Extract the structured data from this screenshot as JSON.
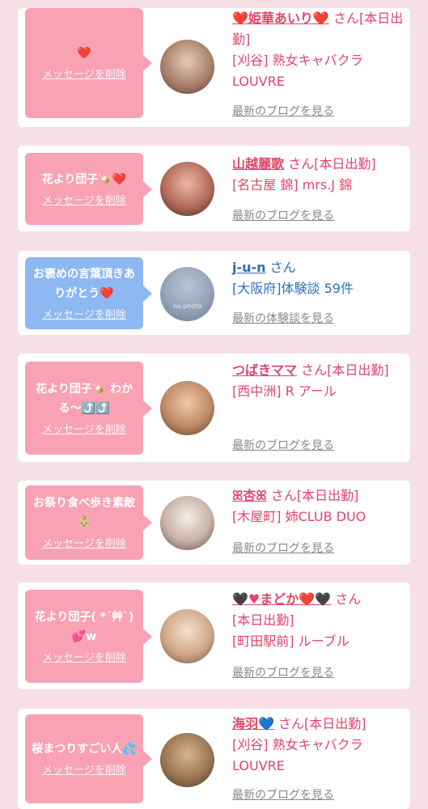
{
  "delete_label": "メッセージを削除",
  "items": [
    {
      "message": "❤️",
      "name": "❤️姫華あいり❤️",
      "san": "さん",
      "status": "[本日出勤]",
      "line1": "[刈谷] 熟女キャバクラ",
      "line2": "LOUVRE",
      "link": "最新のブログを見る",
      "bubble_color": "pink",
      "avatar_colors": [
        "#d8b7a5",
        "#7a5a4c"
      ]
    },
    {
      "message": "花より団子🍡❤️",
      "name": "山越麗歌",
      "san": "さん",
      "status": "[本日出勤]",
      "line1": "[名古屋 錦] mrs.J 錦",
      "line2": "",
      "link": "最新のブログを見る",
      "bubble_color": "pink",
      "avatar_colors": [
        "#e3a58e",
        "#5c3b34"
      ]
    },
    {
      "message": "お褒めの言葉頂きありがとう❤️",
      "name": "j-u-n",
      "san": "さん",
      "status": "",
      "line1": "[大阪府]体験談 59件",
      "line2": "",
      "link": "最新の体験談を見る",
      "bubble_color": "blue",
      "avatar_colors": [
        "#c9d4e2",
        "#8e9bb0"
      ],
      "avatar_text": "no photo"
    },
    {
      "message": "花より団子🍡 わかる〜⤴️⤴️",
      "name": "つばきママ",
      "san": "さん",
      "status": "[本日出勤]",
      "line1": "[西中洲] R アール",
      "line2": "",
      "link": "最新のブログを見る",
      "bubble_color": "pink",
      "avatar_colors": [
        "#d7a884",
        "#6b4630"
      ]
    },
    {
      "message": "お祭り食べ歩き素敵👶🏼",
      "name": "ꕤ杏ꕤ",
      "san": "さん",
      "status": "[本日出勤]",
      "line1": "[木屋町] 姉CLUB DUO",
      "line2": "",
      "link": "最新のブログを見る",
      "bubble_color": "pink",
      "avatar_colors": [
        "#e9dcd2",
        "#7d6a61"
      ]
    },
    {
      "message": "花より団子( *´艸`)💕w",
      "name": "🖤♥まどか❤️🖤",
      "san": "さん",
      "status": "[本日出勤]",
      "line1": "[町田駅前] ルーブル",
      "line2": "",
      "link": "最新のブログを見る",
      "bubble_color": "pink",
      "avatar_colors": [
        "#f0d2b8",
        "#8a6650"
      ]
    },
    {
      "message": "桜まつりすごい人💦",
      "name": "海羽💙",
      "san": "さん",
      "status": "[本日出勤]",
      "line1": "[刈谷] 熟女キャバクラ",
      "line2": "LOUVRE",
      "link": "最新のブログを見る",
      "bubble_color": "pink",
      "avatar_colors": [
        "#c9a37a",
        "#5e4430"
      ]
    }
  ]
}
